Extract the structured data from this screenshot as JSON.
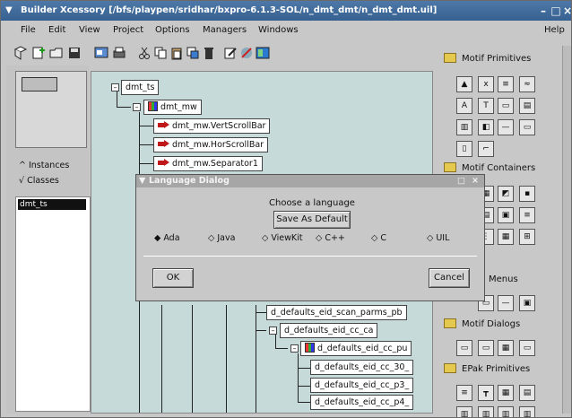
{
  "window": {
    "title": "Builder Xcessory [/bfs/playpen/sridhar/bxpro-6.1.3-SOL/n_dmt_dmt/n_dmt_dmt.uil]",
    "menu_icon": "window-menu-icon",
    "minimize": "–",
    "maximize": "□",
    "close": "×"
  },
  "menubar": {
    "file": "File",
    "edit": "Edit",
    "view": "View",
    "project": "Project",
    "options": "Options",
    "managers": "Managers",
    "windows": "Windows",
    "help": "Help"
  },
  "left": {
    "instances": "Instances",
    "classes": "Classes",
    "selected_item": "dmt_ts"
  },
  "tree": {
    "root": "dmt_ts",
    "mw": "dmt_mw",
    "vscroll": "dmt_mw.VertScrollBar",
    "hscroll": "dmt_mw.HorScrollBar",
    "sep": "dmt_mw.Separator1",
    "d1": "d_defaults_eid_scan_parms_pb",
    "d2": "d_defaults_eid_cc_ca",
    "d3": "d_defaults_eid_cc_pu",
    "d4": "d_defaults_eid_cc_30_",
    "d5": "d_defaults_eid_cc_p3_",
    "d6": "d_defaults_eid_cc_p4_"
  },
  "palette": {
    "motif_primitives": "Motif Primitives",
    "motif_containers": "Motif Containers",
    "menus": "Menus",
    "motif_dialogs": "Motif Dialogs",
    "epak_primitives": "EPak Primitives"
  },
  "dialog": {
    "title": "Language Dialog",
    "prompt": "Choose a language",
    "save_default": "Save As Default",
    "options": [
      "Ada",
      "Java",
      "ViewKit",
      "C++",
      "C",
      "UIL"
    ],
    "selected": "Ada",
    "ok": "OK",
    "cancel": "Cancel"
  }
}
